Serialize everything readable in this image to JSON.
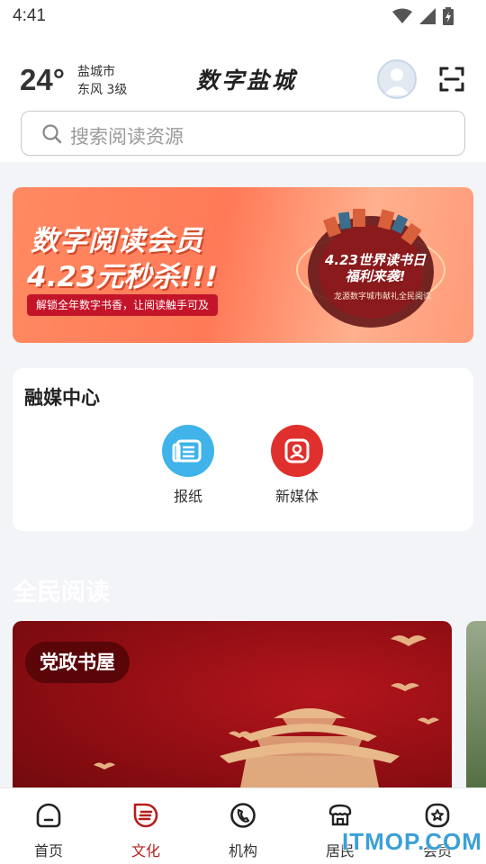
{
  "status_bar": {
    "time": "4:41"
  },
  "header": {
    "temperature": "24°",
    "city": "盐城市",
    "wind": "东风 3级",
    "logo_text": "数字盐城"
  },
  "search": {
    "placeholder": "搜索阅读资源"
  },
  "banner": {
    "headline": "数字阅读会员",
    "sub_headline": "4.23元秒杀!!!",
    "tagline": "解锁全年数字书香，让阅读触手可及",
    "globe_text": "4.23世界读书日 福利来袭!",
    "globe_sub": "龙源数字城市献礼全民阅读"
  },
  "media_center": {
    "title": "融媒中心",
    "items": [
      {
        "label": "报纸",
        "icon": "newspaper-icon",
        "color": "#3fb3ea"
      },
      {
        "label": "新媒体",
        "icon": "new-media-icon",
        "color": "#e0302e"
      }
    ]
  },
  "reading": {
    "title": "全民阅读",
    "feature_badge": "党政书屋"
  },
  "tabbar": {
    "items": [
      {
        "label": "首页",
        "icon": "home-icon"
      },
      {
        "label": "文化",
        "icon": "culture-icon"
      },
      {
        "label": "机构",
        "icon": "institution-icon"
      },
      {
        "label": "居民",
        "icon": "resident-icon"
      },
      {
        "label": "会员",
        "icon": "member-icon"
      }
    ],
    "active_index": 1,
    "active_color": "#b81c1c"
  },
  "watermark": "ITMOP.COM"
}
